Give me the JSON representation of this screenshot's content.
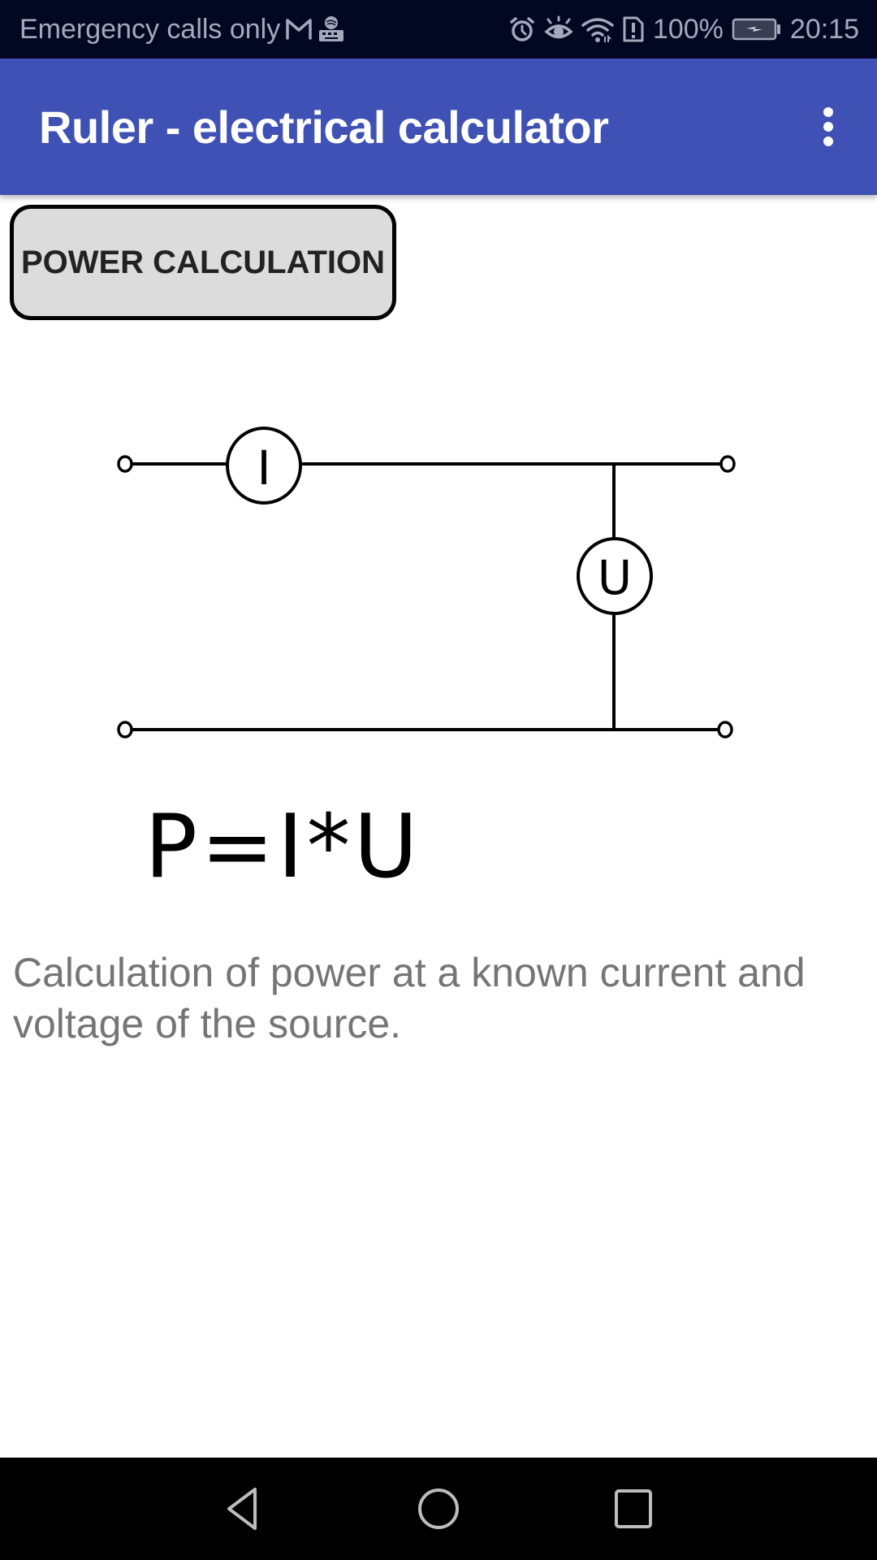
{
  "status_bar": {
    "carrier_text": "Emergency calls only",
    "left_icons": [
      "gmail-icon",
      "swiftkey-keyboard-icon"
    ],
    "right_icons": [
      "alarm-icon",
      "eye-comfort-icon",
      "wifi-icon",
      "sim-alert-icon"
    ],
    "battery_percent": "100%",
    "battery_state": "charging",
    "time": "20:15"
  },
  "app_bar": {
    "title": "Ruler - electrical calculator",
    "menu_icon": "overflow-menu-icon",
    "color": "#3f51b5"
  },
  "main": {
    "button_label": "POWER CALCULATION",
    "circuit": {
      "ammeter_label": "I",
      "voltmeter_label": "U"
    },
    "formula": "P=I*U",
    "description": "Calculation of power at a known current and voltage of the source."
  },
  "nav_bar": {
    "buttons": [
      "back-icon",
      "home-icon",
      "recents-icon"
    ]
  }
}
